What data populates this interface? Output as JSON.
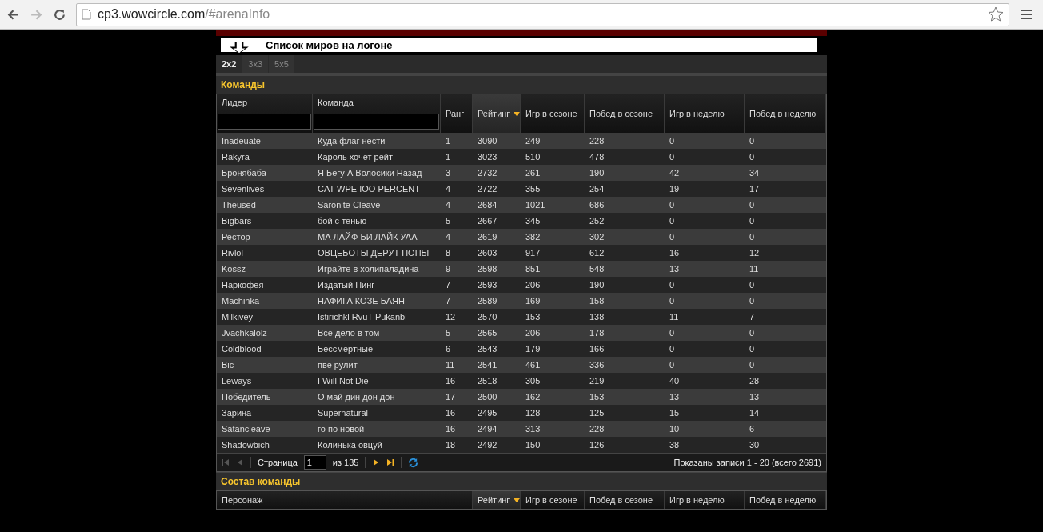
{
  "browser": {
    "url_host": "cp3.wowcircle.com",
    "url_path": "/#arenaInfo"
  },
  "banner": {
    "text": "Список миров на логоне"
  },
  "tabs": [
    {
      "label": "2x2",
      "selected": true
    },
    {
      "label": "3x3",
      "selected": false
    },
    {
      "label": "5x5",
      "selected": false
    }
  ],
  "teams": {
    "title": "Команды",
    "columns": [
      {
        "label": "Лидер",
        "filter": true,
        "sorted": false
      },
      {
        "label": "Команда",
        "filter": true,
        "sorted": false
      },
      {
        "label": "Ранг",
        "filter": false,
        "sorted": false
      },
      {
        "label": "Рейтинг",
        "filter": false,
        "sorted": true
      },
      {
        "label": "Игр в сезоне",
        "filter": false,
        "sorted": false
      },
      {
        "label": "Побед в сезоне",
        "filter": false,
        "sorted": false
      },
      {
        "label": "Игр в неделю",
        "filter": false,
        "sorted": false
      },
      {
        "label": "Побед в неделю",
        "filter": false,
        "sorted": false
      }
    ],
    "rows": [
      [
        "Inadeuate",
        "Куда флаг нести",
        "1",
        "3090",
        "249",
        "228",
        "0",
        "0"
      ],
      [
        "Rakyra",
        "Кароль хочет рейт",
        "1",
        "3023",
        "510",
        "478",
        "0",
        "0"
      ],
      [
        "Бронябаба",
        "Я Бегу А Волосики Назад",
        "3",
        "2732",
        "261",
        "190",
        "42",
        "34"
      ],
      [
        "Sevenlives",
        "CAT WPE IOO PERCENT",
        "4",
        "2722",
        "355",
        "254",
        "19",
        "17"
      ],
      [
        "Theused",
        "Saronite Cleave",
        "4",
        "2684",
        "1021",
        "686",
        "0",
        "0"
      ],
      [
        "Bigbars",
        "бой с тенью",
        "5",
        "2667",
        "345",
        "252",
        "0",
        "0"
      ],
      [
        "Рестор",
        "МА ЛАЙФ БИ ЛАЙК УАА",
        "4",
        "2619",
        "382",
        "302",
        "0",
        "0"
      ],
      [
        "Rivlol",
        "ОВЦЕБОТЫ ДЕРУТ ПОПЫ",
        "8",
        "2603",
        "917",
        "612",
        "16",
        "12"
      ],
      [
        "Kossz",
        "Играйте в холипаладина",
        "9",
        "2598",
        "851",
        "548",
        "13",
        "11"
      ],
      [
        "Наркофея",
        "Издатый Пинг",
        "7",
        "2593",
        "206",
        "190",
        "0",
        "0"
      ],
      [
        "Machinka",
        "НАФИГА КОЗЕ БАЯН",
        "7",
        "2589",
        "169",
        "158",
        "0",
        "0"
      ],
      [
        "Milkivey",
        "Istirichkl RvuT Pukanbl",
        "12",
        "2570",
        "153",
        "138",
        "11",
        "7"
      ],
      [
        "Jvachkalolz",
        "Все дело в том",
        "5",
        "2565",
        "206",
        "178",
        "0",
        "0"
      ],
      [
        "Coldblood",
        "Бессмертные",
        "6",
        "2543",
        "179",
        "166",
        "0",
        "0"
      ],
      [
        "Bic",
        "пве рулит",
        "11",
        "2541",
        "461",
        "336",
        "0",
        "0"
      ],
      [
        "Leways",
        "I Will Not Die",
        "16",
        "2518",
        "305",
        "219",
        "40",
        "28"
      ],
      [
        "Победитель",
        "О май дин дон дон",
        "17",
        "2500",
        "162",
        "153",
        "13",
        "13"
      ],
      [
        "Зарина",
        "Supernatural",
        "16",
        "2495",
        "128",
        "125",
        "15",
        "14"
      ],
      [
        "Satancleave",
        "го по новой",
        "16",
        "2494",
        "313",
        "228",
        "10",
        "6"
      ],
      [
        "Shadowbich",
        "Колинька овцуй",
        "18",
        "2492",
        "150",
        "126",
        "38",
        "30"
      ]
    ],
    "pager": {
      "page_label": "Страница",
      "page": "1",
      "of": "из 135",
      "summary": "Показаны записи 1 - 20 (всего 2691)"
    }
  },
  "members": {
    "title": "Состав команды",
    "columns": [
      {
        "label": "Персонаж",
        "sorted": false
      },
      {
        "label": "Рейтинг",
        "sorted": true
      },
      {
        "label": "Игр в сезоне",
        "sorted": false
      },
      {
        "label": "Побед в сезоне",
        "sorted": false
      },
      {
        "label": "Игр в неделю",
        "sorted": false
      },
      {
        "label": "Побед в неделю",
        "sorted": false
      }
    ]
  }
}
